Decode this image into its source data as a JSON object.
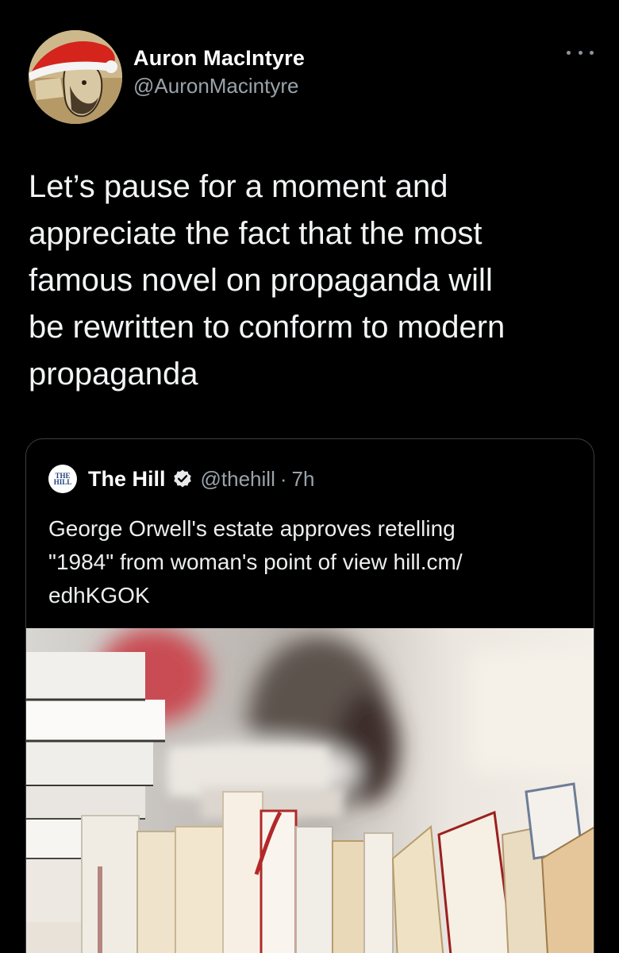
{
  "author": {
    "display_name": "Auron MacIntyre",
    "handle": "@AuronMacintyre"
  },
  "tweet": {
    "text": "Let’s pause for a moment and\nappreciate the fact that the most\nfamous novel on propaganda will\nbe rewritten to conform to modern\npropaganda"
  },
  "quoted": {
    "logo_text_1": "THE",
    "logo_text_2": "HILL",
    "display_name": "The Hill",
    "handle": "@thehill",
    "separator": "·",
    "time": "7h",
    "text": "George Orwell's estate approves retelling\n\"1984\" from woman's point of view hill.cm/\nedhKGOK"
  },
  "icons": {
    "more": "more-options-icon",
    "verified": "verified-badge-icon"
  },
  "colors": {
    "background": "#000000",
    "secondary_text": "#9aa3ab",
    "verified_badge": "#e7e9ea"
  }
}
